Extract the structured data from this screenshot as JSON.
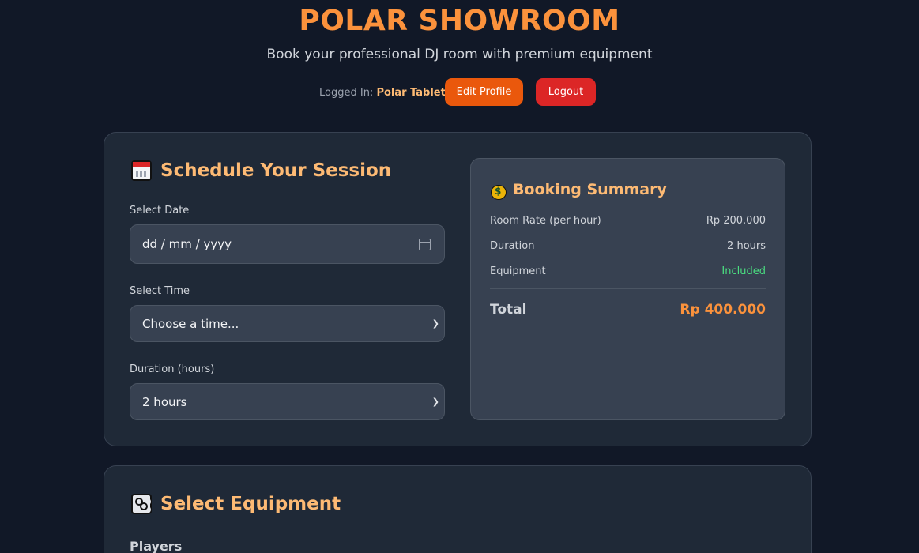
{
  "header": {
    "title": "POLAR SHOWROOM",
    "subtitle": "Book your professional DJ room with premium equipment",
    "logged_in_label": "Logged In:",
    "user_name": "Polar Tablet",
    "edit_profile_label": "Edit Profile",
    "logout_label": "Logout"
  },
  "schedule": {
    "title": "Schedule Your Session",
    "title_icon": "calendar-icon",
    "date_label": "Select Date",
    "date_placeholder": "dd / mm / yyyy",
    "time_label": "Select Time",
    "time_value": "Choose a time...",
    "duration_label": "Duration (hours)",
    "duration_value": "2 hours"
  },
  "summary": {
    "title": "Booking Summary",
    "title_icon": "money-bag-icon",
    "rows": [
      {
        "label": "Room Rate (per hour)",
        "value": "Rp 200.000"
      },
      {
        "label": "Duration",
        "value": "2 hours"
      },
      {
        "label": "Equipment",
        "value": "Included"
      }
    ],
    "total_label": "Total",
    "total_value": "Rp 400.000"
  },
  "equipment": {
    "title": "Select Equipment",
    "title_icon": "dj-controller-icon",
    "players_label": "Players"
  },
  "colors": {
    "background": "#111827",
    "card": "#1f2937",
    "accent": "#fb923c",
    "edit_button": "#ea580c",
    "logout_button": "#dc2626",
    "included": "#4ade80"
  }
}
